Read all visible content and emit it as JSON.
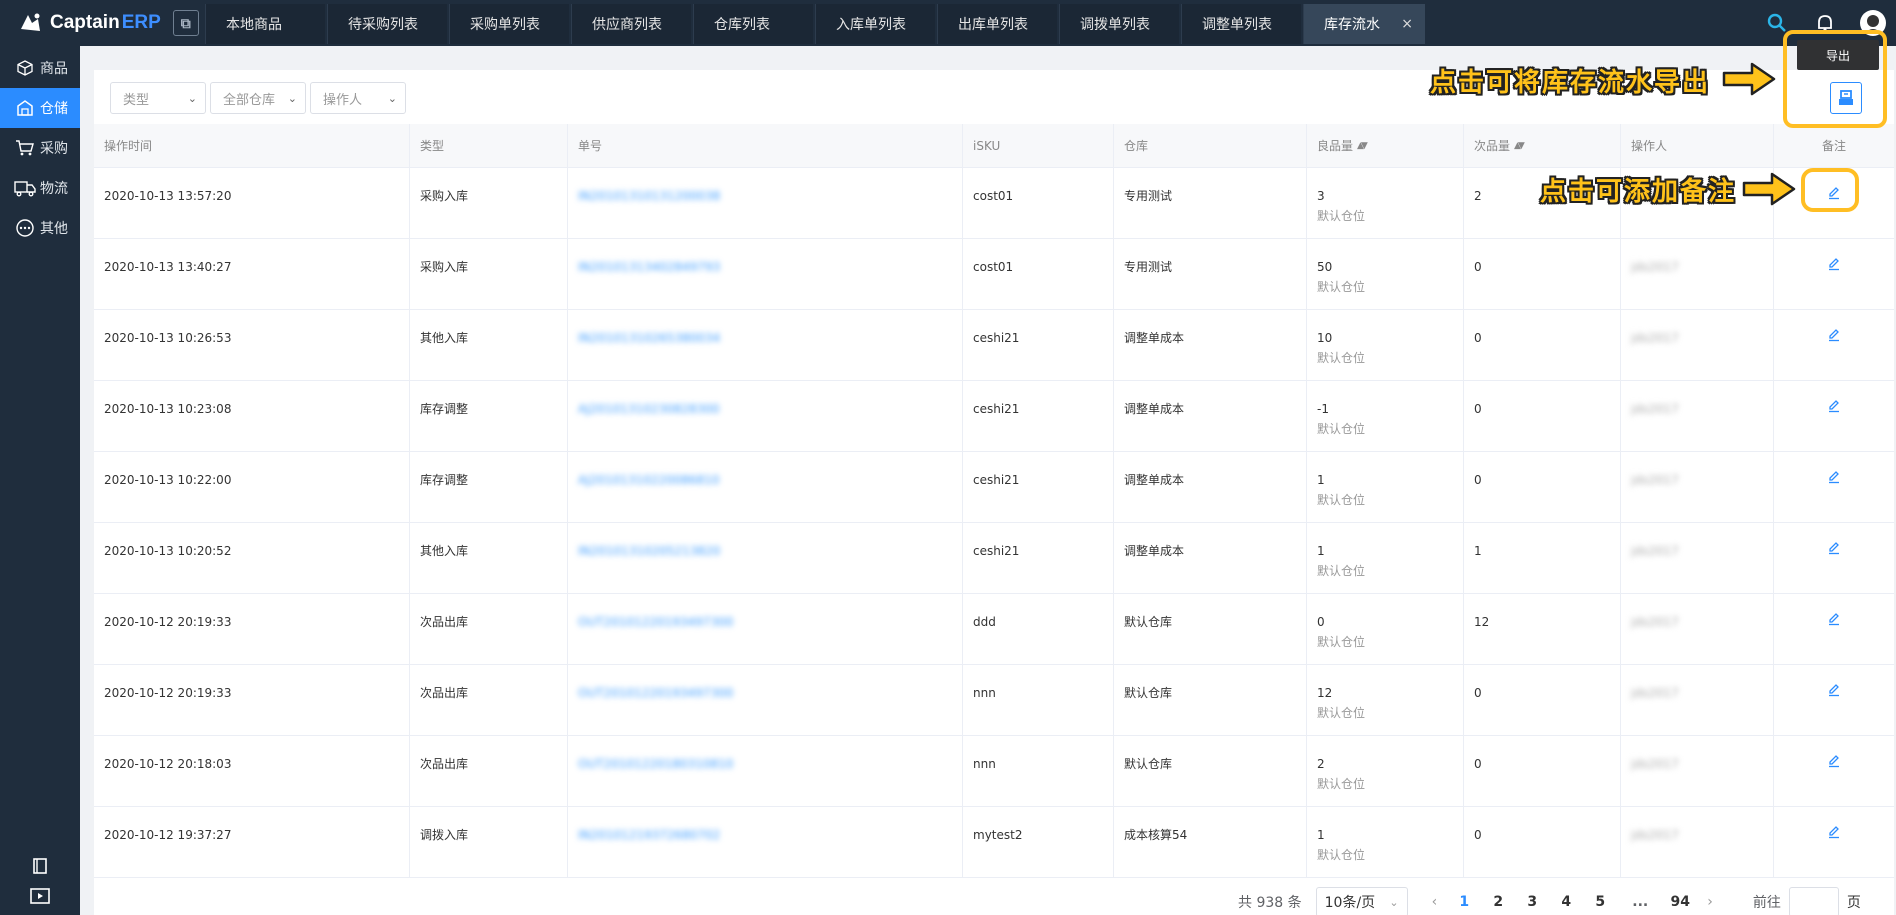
{
  "brand": {
    "name_part1": "Captain",
    "name_part2": "ERP"
  },
  "tabs": [
    {
      "label": "本地商品"
    },
    {
      "label": "待采购列表"
    },
    {
      "label": "采购单列表"
    },
    {
      "label": "供应商列表"
    },
    {
      "label": "仓库列表"
    },
    {
      "label": "入库单列表"
    },
    {
      "label": "出库单列表"
    },
    {
      "label": "调拨单列表"
    },
    {
      "label": "调整单列表"
    },
    {
      "label": "库存流水",
      "close": "×"
    }
  ],
  "sidebar": [
    {
      "label": "商品",
      "icon": "cube-icon"
    },
    {
      "label": "仓储",
      "icon": "warehouse-icon",
      "active": true
    },
    {
      "label": "采购",
      "icon": "cart-icon"
    },
    {
      "label": "物流",
      "icon": "truck-icon"
    },
    {
      "label": "其他",
      "icon": "more-icon"
    }
  ],
  "filters": [
    {
      "placeholder": "类型"
    },
    {
      "placeholder": "全部仓库"
    },
    {
      "placeholder": "操作人"
    }
  ],
  "export": {
    "tooltip": "导出"
  },
  "annotations": {
    "export_hint": "点击可将库存流水导出",
    "remark_hint": "点击可添加备注"
  },
  "table": {
    "headers": [
      "操作时间",
      "类型",
      "单号",
      "iSKU",
      "仓库",
      "良品量",
      "次品量",
      "操作人",
      "备注"
    ],
    "rows": [
      {
        "time": "2020-10-13 13:57:20",
        "type": "采购入库",
        "order": "IN20101310131200038",
        "sku": "cost01",
        "warehouse": "专用测试",
        "good": "3",
        "location": "默认仓位",
        "defect": "2",
        "operator": "jds2017"
      },
      {
        "time": "2020-10-13 13:40:27",
        "type": "采购入库",
        "order": "IN20101313402849793",
        "sku": "cost01",
        "warehouse": "专用测试",
        "good": "50",
        "location": "默认仓位",
        "defect": "0",
        "operator": "jds2017"
      },
      {
        "time": "2020-10-13 10:26:53",
        "type": "其他入库",
        "order": "IN20101310265380034",
        "sku": "ceshi21",
        "warehouse": "调整单成本",
        "good": "10",
        "location": "默认仓位",
        "defect": "0",
        "operator": "jds2017"
      },
      {
        "time": "2020-10-13 10:23:08",
        "type": "库存调整",
        "order": "AJ20101310230828300",
        "sku": "ceshi21",
        "warehouse": "调整单成本",
        "good": "-1",
        "location": "默认仓位",
        "defect": "0",
        "operator": "jds2017"
      },
      {
        "time": "2020-10-13 10:22:00",
        "type": "库存调整",
        "order": "AJ20101310220086810",
        "sku": "ceshi21",
        "warehouse": "调整单成本",
        "good": "1",
        "location": "默认仓位",
        "defect": "0",
        "operator": "jds2017"
      },
      {
        "time": "2020-10-13 10:20:52",
        "type": "其他入库",
        "order": "IN20101310205213820",
        "sku": "ceshi21",
        "warehouse": "调整单成本",
        "good": "1",
        "location": "默认仓位",
        "defect": "1",
        "operator": "jds2017"
      },
      {
        "time": "2020-10-12 20:19:33",
        "type": "次品出库",
        "order": "OUT20101220193497300",
        "sku": "ddd",
        "warehouse": "默认仓库",
        "good": "0",
        "location": "默认仓位",
        "defect": "12",
        "operator": "jds2017"
      },
      {
        "time": "2020-10-12 20:19:33",
        "type": "次品出库",
        "order": "OUT20101220193497300",
        "sku": "nnn",
        "warehouse": "默认仓库",
        "good": "12",
        "location": "默认仓位",
        "defect": "0",
        "operator": "jds2017"
      },
      {
        "time": "2020-10-12 20:18:03",
        "type": "次品出库",
        "order": "OUT20101220180310810",
        "sku": "nnn",
        "warehouse": "默认仓库",
        "good": "2",
        "location": "默认仓位",
        "defect": "0",
        "operator": "jds2017"
      },
      {
        "time": "2020-10-12 19:37:27",
        "type": "调拨入库",
        "order": "IN20101219372680702",
        "sku": "mytest2",
        "warehouse": "成本核算54",
        "good": "1",
        "location": "默认仓位",
        "defect": "0",
        "operator": "jds2017"
      }
    ]
  },
  "pagination": {
    "total": "共 938 条",
    "page_size": "10条/页",
    "pages": [
      "1",
      "2",
      "3",
      "4",
      "5",
      "...",
      "94"
    ],
    "current": "1",
    "goto_label": "前往",
    "page_suffix": "页"
  },
  "colors": {
    "accent": "#2b8cff",
    "nav_bg": "#1f2d3d",
    "highlight": "#ffbe24"
  }
}
